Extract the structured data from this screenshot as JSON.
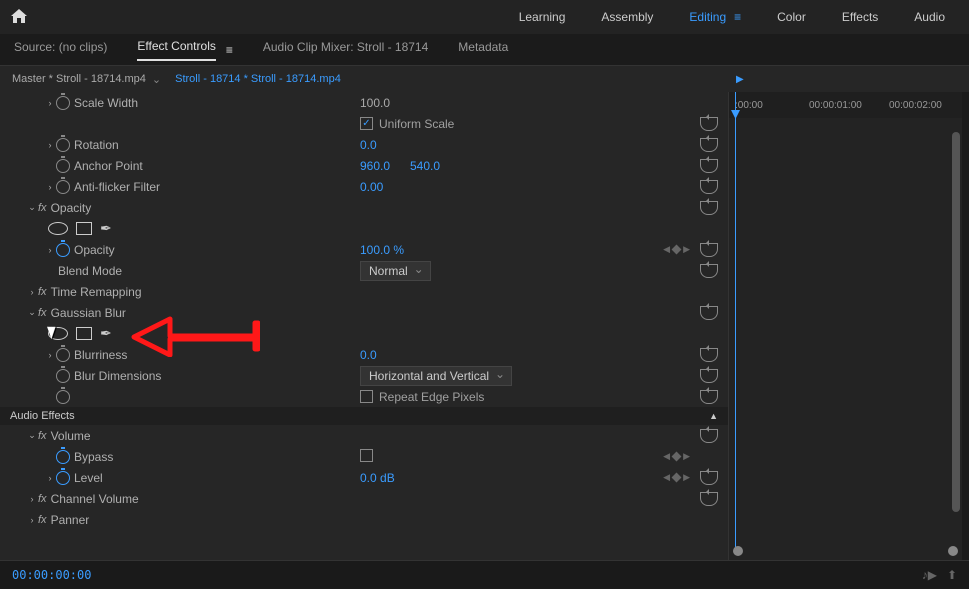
{
  "workspaces": [
    "Learning",
    "Assembly",
    "Editing",
    "Color",
    "Effects",
    "Audio"
  ],
  "active_workspace": "Editing",
  "panel_tabs": {
    "source": "Source: (no clips)",
    "effect_controls": "Effect Controls",
    "audio_mixer": "Audio Clip Mixer: Stroll - 18714",
    "metadata": "Metadata"
  },
  "clip": {
    "master": "Master * Stroll - 18714.mp4",
    "sequence": "Stroll - 18714 * Stroll - 18714.mp4"
  },
  "ruler": {
    "t0": ":00:00",
    "t1": "00:00:01:00",
    "t2": "00:00:02:00"
  },
  "motion": {
    "scale_width_label": "Scale Width",
    "scale_width_value": "100.0",
    "uniform_scale": "Uniform Scale",
    "rotation_label": "Rotation",
    "rotation_value": "0.0",
    "anchor_label": "Anchor Point",
    "anchor_x": "960.0",
    "anchor_y": "540.0",
    "antiflicker_label": "Anti-flicker Filter",
    "antiflicker_value": "0.00"
  },
  "opacity": {
    "section": "Opacity",
    "opacity_label": "Opacity",
    "opacity_value": "100.0 %",
    "blend_label": "Blend Mode",
    "blend_value": "Normal"
  },
  "time_remap": "Time Remapping",
  "gaussian": {
    "section": "Gaussian Blur",
    "blurriness_label": "Blurriness",
    "blurriness_value": "0.0",
    "dimensions_label": "Blur Dimensions",
    "dimensions_value": "Horizontal and Vertical",
    "repeat_label": "Repeat Edge Pixels"
  },
  "audio_section": "Audio Effects",
  "volume": {
    "section": "Volume",
    "bypass_label": "Bypass",
    "level_label": "Level",
    "level_value": "0.0 dB"
  },
  "channel_volume": "Channel Volume",
  "panner": "Panner",
  "timecode": "00:00:00:00"
}
